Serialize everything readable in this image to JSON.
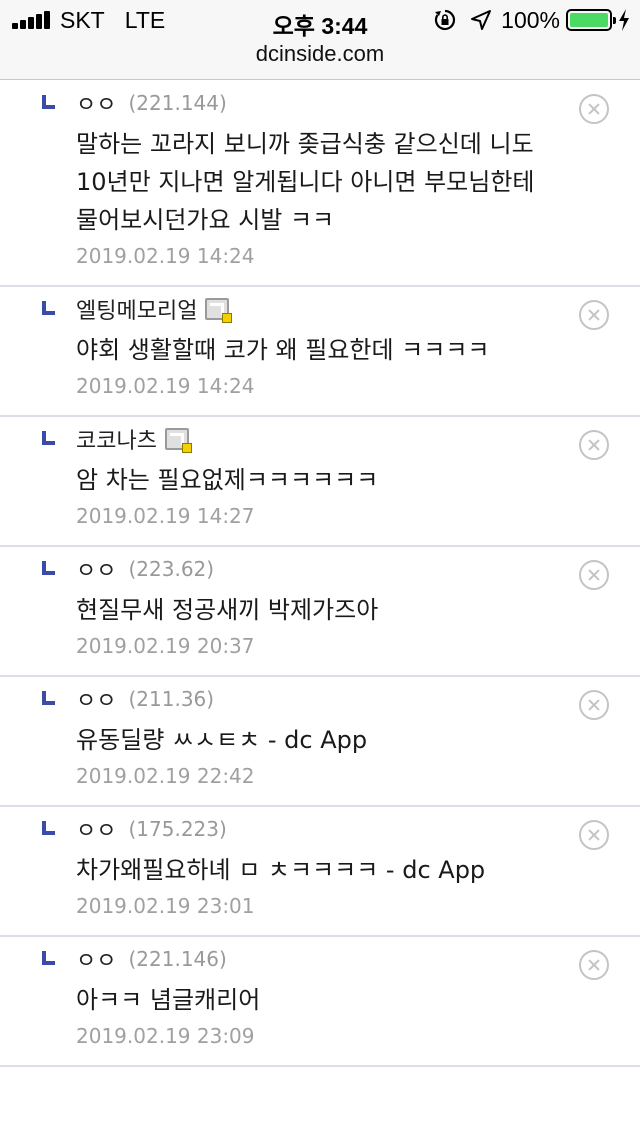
{
  "status_bar": {
    "carrier": "SKT",
    "network": "LTE",
    "time": "오후 3:44",
    "battery_percent": "100%",
    "battery_level": 1.0,
    "icons": [
      "signal-icon",
      "orientation-lock-icon",
      "location-icon",
      "battery-icon",
      "charging-icon"
    ]
  },
  "browser": {
    "url": "dcinside.com"
  },
  "comments": [
    {
      "author": "ㅇㅇ",
      "ip": "(221.144)",
      "memo": "말하는 꼬라지 보니까 좆급식충 같으신데 니도 10년만 지나면 알게됩니다 아니면 부모님한테 물어보시던가요 시발 ㅋㅋ",
      "date": "2019.02.19 14:24",
      "gallog": false
    },
    {
      "author": "엘팅메모리얼",
      "ip": "",
      "memo": "야회 생활할때 코가 왜 필요한데 ㅋㅋㅋㅋ",
      "date": "2019.02.19 14:24",
      "gallog": true
    },
    {
      "author": "코코나츠",
      "ip": "",
      "memo": "암 차는 필요없제ㅋㅋㅋㅋㅋㅋ",
      "date": "2019.02.19 14:27",
      "gallog": true
    },
    {
      "author": "ㅇㅇ",
      "ip": "(223.62)",
      "memo": "현질무새 정공새끼 박제가즈아",
      "date": "2019.02.19 20:37",
      "gallog": false
    },
    {
      "author": "ㅇㅇ",
      "ip": "(211.36)",
      "memo": "유동딜량 ㅆㅅㅌㅊ - dc App",
      "date": "2019.02.19 22:42",
      "gallog": false
    },
    {
      "author": "ㅇㅇ",
      "ip": "(175.223)",
      "memo": "차가왜필요하녜 ㅁ ㅊㅋㅋㅋㅋ - dc App",
      "date": "2019.02.19 23:01",
      "gallog": false
    },
    {
      "author": "ㅇㅇ",
      "ip": "(221.146)",
      "memo": "아ㅋㅋ 념글캐리어",
      "date": "2019.02.19 23:09",
      "gallog": false
    }
  ],
  "colors": {
    "reply_mark": "#3b4ba8",
    "date_text": "#a0a0a0",
    "ip_text": "#999999",
    "divider": "#dcdcea",
    "battery": "#4cd964"
  }
}
